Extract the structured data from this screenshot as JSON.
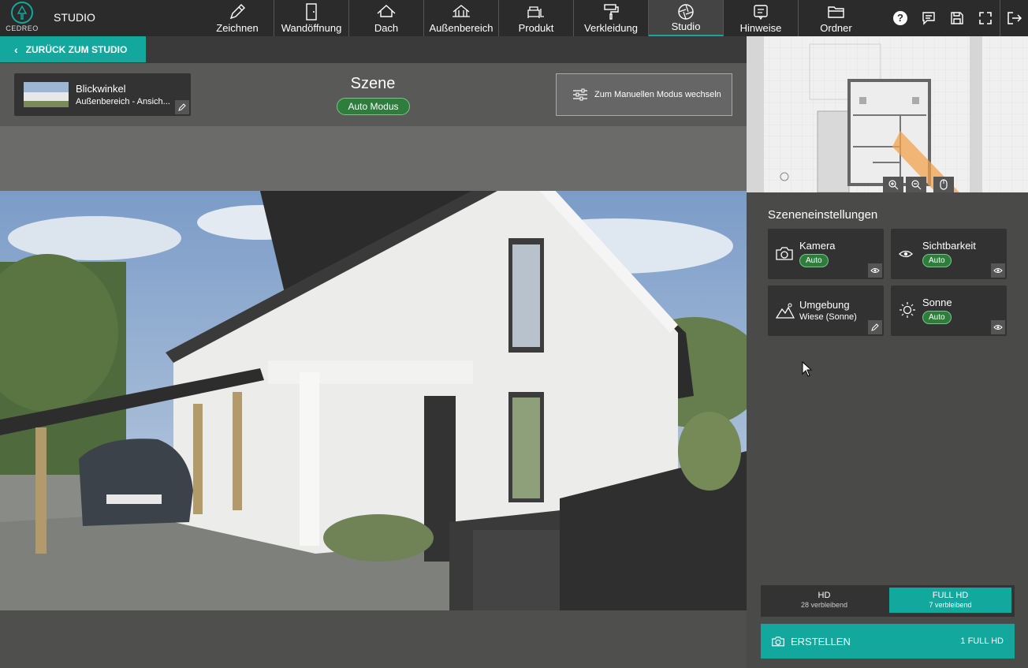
{
  "app": {
    "brand": "CEDREO",
    "section": "STUDIO"
  },
  "nav": [
    {
      "label": "Zeichnen",
      "icon": "pencil-icon"
    },
    {
      "label": "Wandöffnung",
      "icon": "door-icon"
    },
    {
      "label": "Dach",
      "icon": "roof-icon"
    },
    {
      "label": "Außenbereich",
      "icon": "outdoor-icon"
    },
    {
      "label": "Produkt",
      "icon": "sofa-icon"
    },
    {
      "label": "Verkleidung",
      "icon": "paint-roller-icon"
    },
    {
      "label": "Studio",
      "icon": "camera-aperture-icon",
      "active": true
    },
    {
      "label": "Hinweise",
      "icon": "note-icon"
    },
    {
      "label": "Ordner",
      "icon": "folder-icon"
    }
  ],
  "back": {
    "label": "ZURÜCK ZUM STUDIO"
  },
  "view": {
    "title": "Blickwinkel",
    "subtitle": "Außenbereich - Ansich..."
  },
  "scene": {
    "title": "Szene",
    "mode": "Auto Modus",
    "manual_label": "Zum Manuellen Modus wechseln"
  },
  "settings": {
    "title": "Szeneneinstellungen",
    "cards": [
      {
        "label": "Kamera",
        "badge": "Auto",
        "icon": "camera-icon",
        "action": "eye-icon"
      },
      {
        "label": "Sichtbarkeit",
        "badge": "Auto",
        "icon": "eye-icon",
        "action": "eye-icon"
      },
      {
        "label": "Umgebung",
        "value": "Wiese (Sonne)",
        "icon": "mountain-icon",
        "action": "edit-icon"
      },
      {
        "label": "Sonne",
        "badge": "Auto",
        "icon": "sun-icon",
        "action": "eye-icon"
      }
    ]
  },
  "quality": {
    "hd": {
      "label": "HD",
      "remaining": "28 verbleibend"
    },
    "fullhd": {
      "label": "FULL HD",
      "remaining": "7 verbleibend",
      "selected": true
    }
  },
  "create": {
    "label": "ERSTELLEN",
    "quota": "1 FULL HD"
  },
  "colors": {
    "accent": "#13a89e",
    "pill": "#2e7d3c",
    "topbar": "#2b2b2b"
  }
}
